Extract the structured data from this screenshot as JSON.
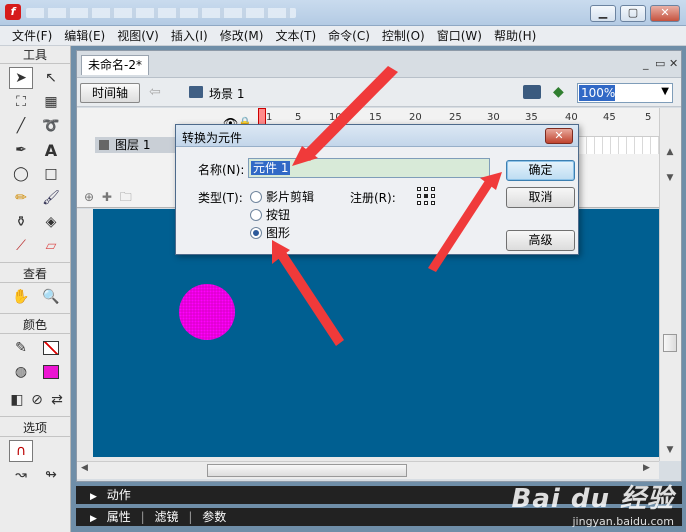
{
  "menu": [
    "文件(F)",
    "编辑(E)",
    "视图(V)",
    "插入(I)",
    "修改(M)",
    "文本(T)",
    "命令(C)",
    "控制(O)",
    "窗口(W)",
    "帮助(H)"
  ],
  "tools": {
    "header": "工具",
    "view_header": "查看",
    "color_header": "颜色",
    "options_header": "选项"
  },
  "document": {
    "tab_title": "未命名-2*",
    "timeline_button": "时间轴",
    "scene_label": "场景 1",
    "zoom": "100%",
    "layer_name": "图层 1",
    "ruler": [
      "1",
      "5",
      "10",
      "15",
      "20",
      "25",
      "30",
      "35",
      "40",
      "45",
      "5"
    ]
  },
  "dialog": {
    "title": "转换为元件",
    "name_label": "名称(N):",
    "name_value": "元件 1",
    "type_label": "类型(T):",
    "types": [
      "影片剪辑",
      "按钮",
      "图形"
    ],
    "selected_type": "图形",
    "registration_label": "注册(R):",
    "ok": "确定",
    "cancel": "取消",
    "advanced": "高级"
  },
  "panels": {
    "actions": "动作",
    "properties": "属性",
    "filters": "滤镜",
    "parameters": "参数"
  },
  "watermark": {
    "brand": "Bai du 经验",
    "url": "jingyan.baidu.com"
  },
  "colors": {
    "stage": "#005f91",
    "circle": "#ec15d2",
    "arrow": "#f03a3a"
  }
}
